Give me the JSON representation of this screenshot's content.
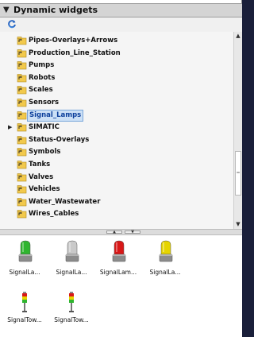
{
  "panel": {
    "title": "Dynamic widgets",
    "refresh_icon": "refresh-icon"
  },
  "tree": {
    "items": [
      {
        "label": "Pipes-Overlays+Arrows",
        "selected": false,
        "expandable": false
      },
      {
        "label": "Production_Line_Station",
        "selected": false,
        "expandable": false
      },
      {
        "label": "Pumps",
        "selected": false,
        "expandable": false
      },
      {
        "label": "Robots",
        "selected": false,
        "expandable": false
      },
      {
        "label": "Scales",
        "selected": false,
        "expandable": false
      },
      {
        "label": "Sensors",
        "selected": false,
        "expandable": false
      },
      {
        "label": "Signal_Lamps",
        "selected": true,
        "expandable": false
      },
      {
        "label": "SIMATIC",
        "selected": false,
        "expandable": true
      },
      {
        "label": "Status-Overlays",
        "selected": false,
        "expandable": false
      },
      {
        "label": "Symbols",
        "selected": false,
        "expandable": false
      },
      {
        "label": "Tanks",
        "selected": false,
        "expandable": false
      },
      {
        "label": "Valves",
        "selected": false,
        "expandable": false
      },
      {
        "label": "Vehicles",
        "selected": false,
        "expandable": false
      },
      {
        "label": "Water_Wastewater",
        "selected": false,
        "expandable": false
      },
      {
        "label": "Wires_Cables",
        "selected": false,
        "expandable": false
      }
    ]
  },
  "gallery": {
    "items": [
      {
        "caption": "SignalLa...",
        "kind": "lamp",
        "color": "#2fb52f"
      },
      {
        "caption": "SignalLa...",
        "kind": "lamp",
        "color": "#c9c9c9"
      },
      {
        "caption": "SignalLam...",
        "kind": "lamp",
        "color": "#d81818"
      },
      {
        "caption": "SignalLa...",
        "kind": "lamp",
        "color": "#e6d400"
      },
      {
        "caption": "SignalTow...",
        "kind": "tower"
      },
      {
        "caption": "SignalTow...",
        "kind": "tower"
      }
    ]
  },
  "colors": {
    "selection_bg": "#cce0f6",
    "selection_text": "#0b3e9b",
    "folder_yellow": "#f2c94c",
    "background_outer": "#1a1f3a"
  }
}
